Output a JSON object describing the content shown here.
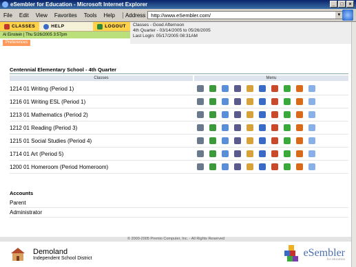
{
  "window": {
    "title": "eSembler for Education - Microsoft Internet Explorer",
    "controls": [
      "_",
      "□",
      "×"
    ]
  },
  "menubar": {
    "items": [
      "File",
      "Edit",
      "View",
      "Favorites",
      "Tools",
      "Help"
    ],
    "address_label": "Address",
    "address_value": "http://www.eSembler.com/"
  },
  "nav": {
    "classes": "CLASSES",
    "help": "HELP",
    "logout": "LOGOUT"
  },
  "user": {
    "line": "Al Einstein | Thu 5/26/2005 3:57pm",
    "preferences": "Preferences"
  },
  "info": {
    "greeting": "Classes - Good Afternoon",
    "quarter": "4th Quarter - 03/14/2005 to 05/26/2005",
    "last_login": "Last Login: 05/17/2005 08:31AM"
  },
  "main": {
    "school": "Centennial Elementary School - 4th Quarter",
    "col_classes": "Classes",
    "col_menu": "Menu",
    "classes": [
      "1214 01 Writing (Period 1)",
      "1216 01 Writing ESL (Period 1)",
      "1213 01 Mathematics (Period 2)",
      "1212 01 Reading (Period 3)",
      "1215 01 Social Studies (Period 4)",
      "1714 01 Art (Period 5)",
      "1200 01 Homeroom (Period Homeroom)"
    ],
    "menu_icons": [
      "grades-icon",
      "people-icon",
      "document-icon",
      "calendar-icon",
      "notes-icon",
      "email-icon",
      "award-icon",
      "checklist-icon",
      "report-icon",
      "cursor-icon"
    ],
    "icon_colors": [
      "#6a7a8c",
      "#3c9a3c",
      "#5a8fd8",
      "#5a5a8c",
      "#d8a23a",
      "#3a6ac8",
      "#c84a2a",
      "#3aa83a",
      "#d86a1a",
      "#8ab0e8"
    ]
  },
  "accounts": {
    "heading": "Accounts",
    "items": [
      "Parent",
      "Administrator"
    ]
  },
  "footer": {
    "copyright": "© 2000-2005 Premio Computer, Inc. - All Rights Reserved",
    "district_name": "Demoland",
    "district_sub": "Independent School District",
    "brand": "eSembler",
    "brand_sub": "for education"
  }
}
